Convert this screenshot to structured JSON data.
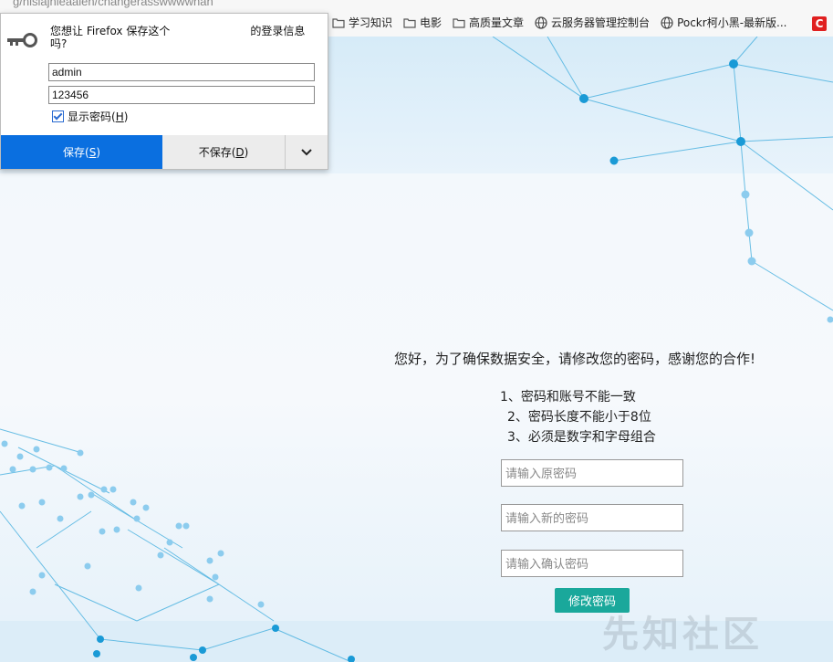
{
  "address_bar": {
    "url_fragment": "g/nisiajnieaaien/cnangerasswwwwnan"
  },
  "bookmarks": [
    {
      "icon": "folder-icon",
      "label": "学习知识"
    },
    {
      "icon": "folder-icon",
      "label": "电影"
    },
    {
      "icon": "folder-icon",
      "label": "高质量文章"
    },
    {
      "icon": "globe-icon",
      "label": "云服务器管理控制台"
    },
    {
      "icon": "globe-icon",
      "label": "Pockr柯小黑-最新版..."
    }
  ],
  "bookmark_last_icon": {
    "icon": "c-logo-icon",
    "glyph": "C"
  },
  "save_login_popup": {
    "message_line1": "您想让 Firefox 保存这个",
    "message_line1_tail": "的登录信息",
    "message_line2": "吗?",
    "username": "admin",
    "password": "123456",
    "show_password_label": "显示密码(",
    "show_password_key": "H",
    "show_password_end": ")",
    "show_password_checked": true,
    "save_label": "保存(",
    "save_key": "S",
    "save_end": ")",
    "dont_save_label": "不保存(",
    "dont_save_key": "D",
    "dont_save_end": ")",
    "more_icon": "chevron-down-icon"
  },
  "form": {
    "greeting": "您好，为了确保数据安全，请修改您的密码，感谢您的合作!",
    "rules": [
      "1、密码和账号不能一致",
      "2、密码长度不能小于8位",
      "3、必须是数字和字母组合"
    ],
    "old_password_placeholder": "请输入原密码",
    "new_password_placeholder": "请输入新的密码",
    "confirm_password_placeholder": "请输入确认密码",
    "submit_label": "修改密码"
  },
  "watermark": "先知社区",
  "colors": {
    "save_button": "#0a6fe0",
    "submit_button": "#1aa89b",
    "network_line": "#4fb3e0"
  }
}
